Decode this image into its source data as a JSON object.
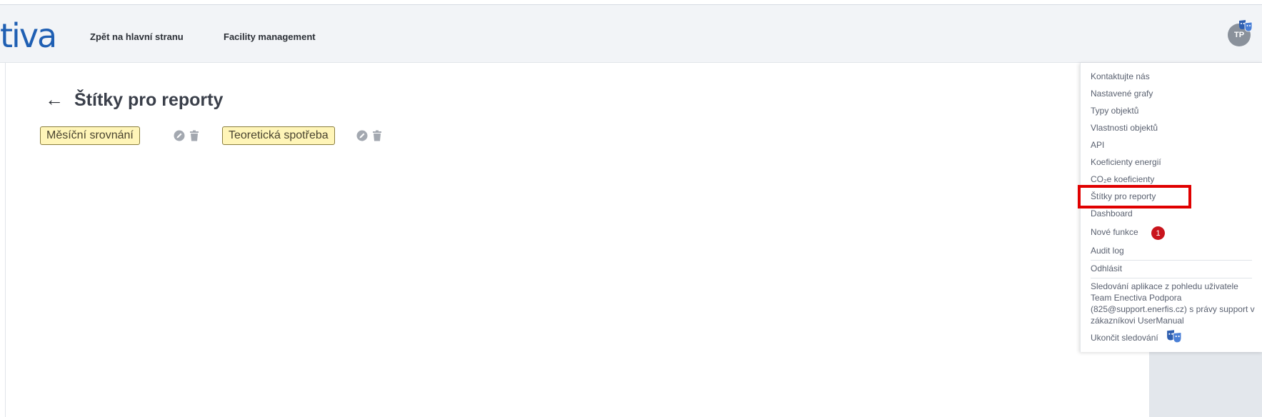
{
  "header": {
    "logo_text": "tiva",
    "nav": {
      "back_home": "Zpět na hlavní stranu",
      "facility": "Facility management"
    },
    "avatar_initials": "TP"
  },
  "page": {
    "back_icon": "arrow-left-icon",
    "title": "Štítky pro reporty",
    "tags": [
      {
        "label": "Měsíční srovnání"
      },
      {
        "label": "Teoretická spotřeba"
      }
    ]
  },
  "menu": {
    "items": [
      "Kontaktujte nás",
      "Nastavené grafy",
      "Typy objektů",
      "Vlastnosti objektů",
      "API",
      "Koeficienty energií",
      "CO₂e koeficienty",
      "Štítky pro reporty",
      "Dashboard"
    ],
    "new_features": "Nové funkce",
    "new_features_count": "1",
    "audit_log": "Audit log",
    "logout": "Odhlásit",
    "impersonation_info": "Sledování aplikace z pohledu uživatele Team Enectiva Podpora (825@support.enerfis.cz) s právy support v zákazníkovi UserManual",
    "end_impersonation": "Ukončit sledování"
  },
  "colors": {
    "brand_blue": "#1f5fb3",
    "tag_bg": "#fff5b8",
    "highlight": "#e00000",
    "badge": "#c9141c"
  }
}
